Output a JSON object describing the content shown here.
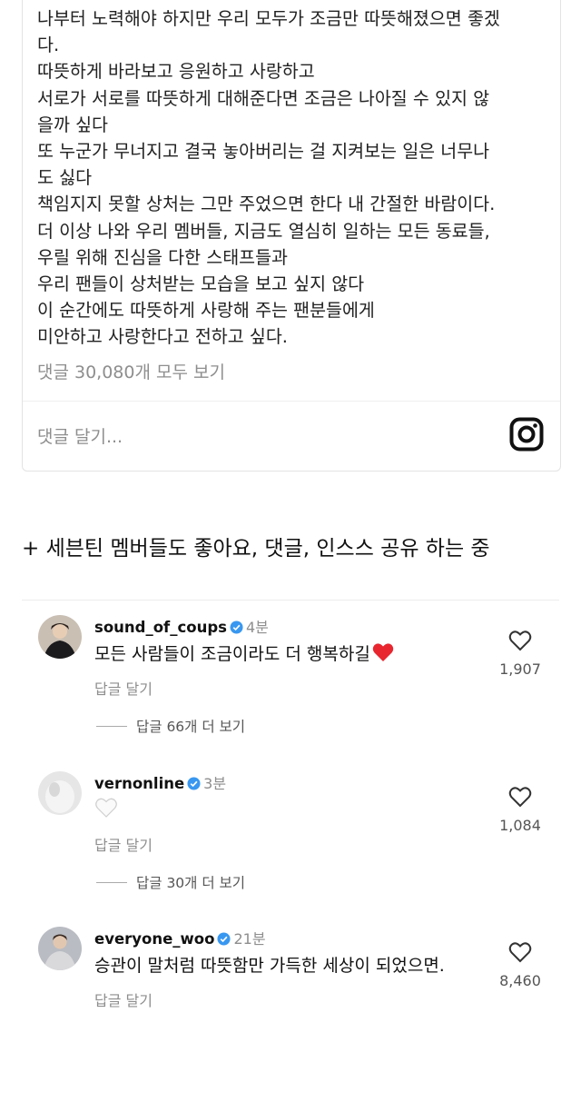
{
  "post": {
    "caption_lines": [
      "나부터 노력해야 하지만 우리 모두가 조금만 따뜻해졌으면 좋겠",
      "다.",
      "따뜻하게 바라보고 응원하고 사랑하고",
      "서로가 서로를 따뜻하게 대해준다면 조금은 나아질 수 있지 않",
      "을까 싶다",
      "또 누군가 무너지고 결국 놓아버리는 걸 지켜보는 일은 너무나",
      "도 싫다",
      "책임지지 못할 상처는 그만 주었으면 한다 내 간절한 바람이다.",
      "더 이상 나와 우리 멤버들, 지금도 열심히 일하는 모든 동료들,",
      "우릴 위해 진심을 다한 스태프들과",
      "우리 팬들이 상처받는 모습을 보고 싶지 않다",
      "이 순간에도 따뜻하게 사랑해 주는 팬분들에게",
      "미안하고 사랑한다고 전하고 싶다."
    ],
    "view_all_comments": "댓글 30,080개 모두 보기",
    "add_comment_placeholder": "댓글 달기..."
  },
  "headline": "+ 세븐틴 멤버들도 좋아요, 댓글, 인스스 공유 하는 중",
  "comments": [
    {
      "username": "sound_of_coups",
      "time": "4분",
      "text": "모든 사람들이 조금이라도 더 행복하길",
      "emoji": "red-heart",
      "reply_label": "답글 달기",
      "likes": "1,907",
      "more_replies": "답글 66개 더 보기"
    },
    {
      "username": "vernonline",
      "time": "3분",
      "text": "",
      "emoji": "white-heart",
      "reply_label": "답글 달기",
      "likes": "1,084",
      "more_replies": "답글 30개 더 보기"
    },
    {
      "username": "everyone_woo",
      "time": "21분",
      "text": "승관이 말처럼 따뜻함만 가득한 세상이 되었으면.",
      "emoji": "",
      "reply_label": "답글 달기",
      "likes": "8,460",
      "more_replies": ""
    }
  ],
  "colors": {
    "verified": "#3897f0",
    "muted": "#8e8e8e",
    "heart": "#e8262f"
  }
}
